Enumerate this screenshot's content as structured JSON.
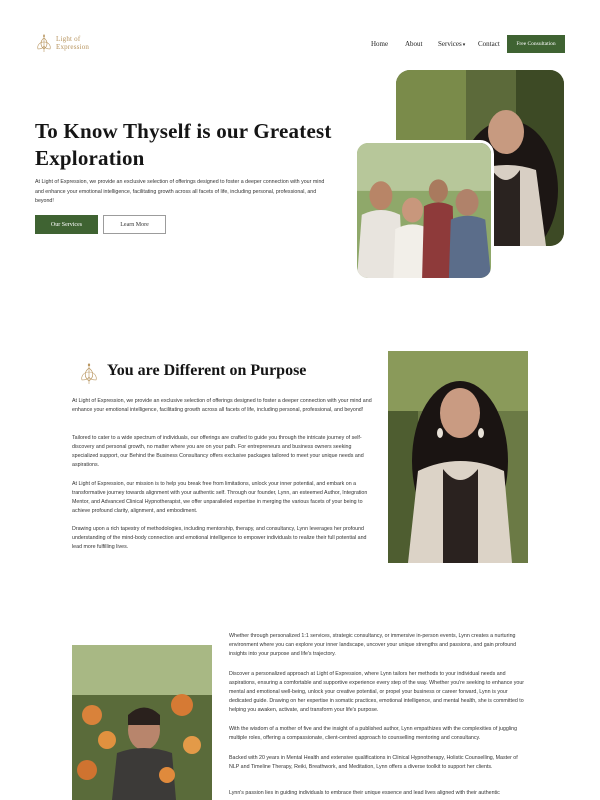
{
  "brand": {
    "line1": "Light of",
    "line2": "Expression"
  },
  "nav": {
    "items": [
      {
        "label": "Home"
      },
      {
        "label": "About"
      },
      {
        "label": "Services"
      },
      {
        "label": "Contact"
      }
    ],
    "services_caret": "▾",
    "cta": "Free Consultation"
  },
  "hero": {
    "title": "To Know Thyself is our Greatest Exploration",
    "body": "At Light of Expression, we provide an exclusive selection of offerings designed to foster a deeper connection with your mind and enhance your emotional intelligence, facilitating growth across all facets of life, including personal, professional, and beyond!",
    "primary_button": "Our Services",
    "secondary_button": "Learn More"
  },
  "purpose": {
    "title": "You are Different on Purpose",
    "paragraphs": [
      "At Light of Expression, we provide an exclusive selection of offerings designed to foster a deeper connection with your mind and enhance your emotional intelligence, facilitating growth across all facets of life, including personal, professional, and beyond!",
      "Tailored to cater to a wide spectrum of individuals, our offerings are crafted to guide you through the intricate journey of self-discovery and personal growth, no matter where you are on your path. For entrepreneurs and business owners seeking specialized support, our Behind the Business Consultancy offers exclusive packages tailored to meet your unique needs and aspirations.",
      "At Light of Expression, our mission is to help you break free from limitations, unlock your inner potential, and embark on a transformative journey towards alignment with your authentic self. Through our founder, Lynn, an esteemed Author, Integration Mentor, and Advanced Clinical Hypnotherapist, we offer unparalleled expertise in merging the various facets of your being to achieve profound clarity, alignment, and embodiment.",
      "Drawing upon a rich tapestry of methodologies, including mentorship, therapy, and consultancy, Lynn leverages her profound understanding of the mind-body connection and emotional intelligence to empower individuals to realize their full potential and lead more fulfilling lives."
    ]
  },
  "about_lynn": {
    "paragraphs": [
      "Whether through personalized 1:1 services, strategic consultancy, or immersive in-person events, Lynn creates a nurturing environment where you can explore your inner landscape, uncover your unique strengths and passions, and gain profound insights into your purpose and life's trajectory.",
      "Discover a personalized approach at Light of Expression, where Lynn tailors her methods to your individual needs and aspirations, ensuring a comfortable and supportive experience every step of the way. Whether you're seeking to enhance your mental and emotional well-being, unlock your creative potential, or propel your business or career forward, Lynn is your dedicated guide. Drawing on her expertise in somatic practices, emotional intelligence, and mental health, she is committed to helping you awaken, activate, and transform your life's purpose.",
      "With the wisdom of a mother of five and the insight of a published author, Lynn empathizes with the complexities of juggling multiple roles, offering a compassionate, client-centred approach to counselling mentoring and consultancy.",
      "Backed with 20 years in Mental Health and extensive qualifications in Clinical Hypnotherapy, Holistic Counselling, Master of NLP and Timeline Therapy, Reiki, Breathwork, and Meditation, Lynn offers a diverse toolkit to support her clients.",
      "Lynn's passion lies in guiding individuals to embrace their unique essence and lead lives aligned with their authentic"
    ]
  },
  "colors": {
    "accent": "#3f6332",
    "gold": "#b8955f",
    "text": "#151515"
  },
  "icons": {
    "logo": "lotus-icon",
    "section": "lotus-emblem-icon"
  }
}
